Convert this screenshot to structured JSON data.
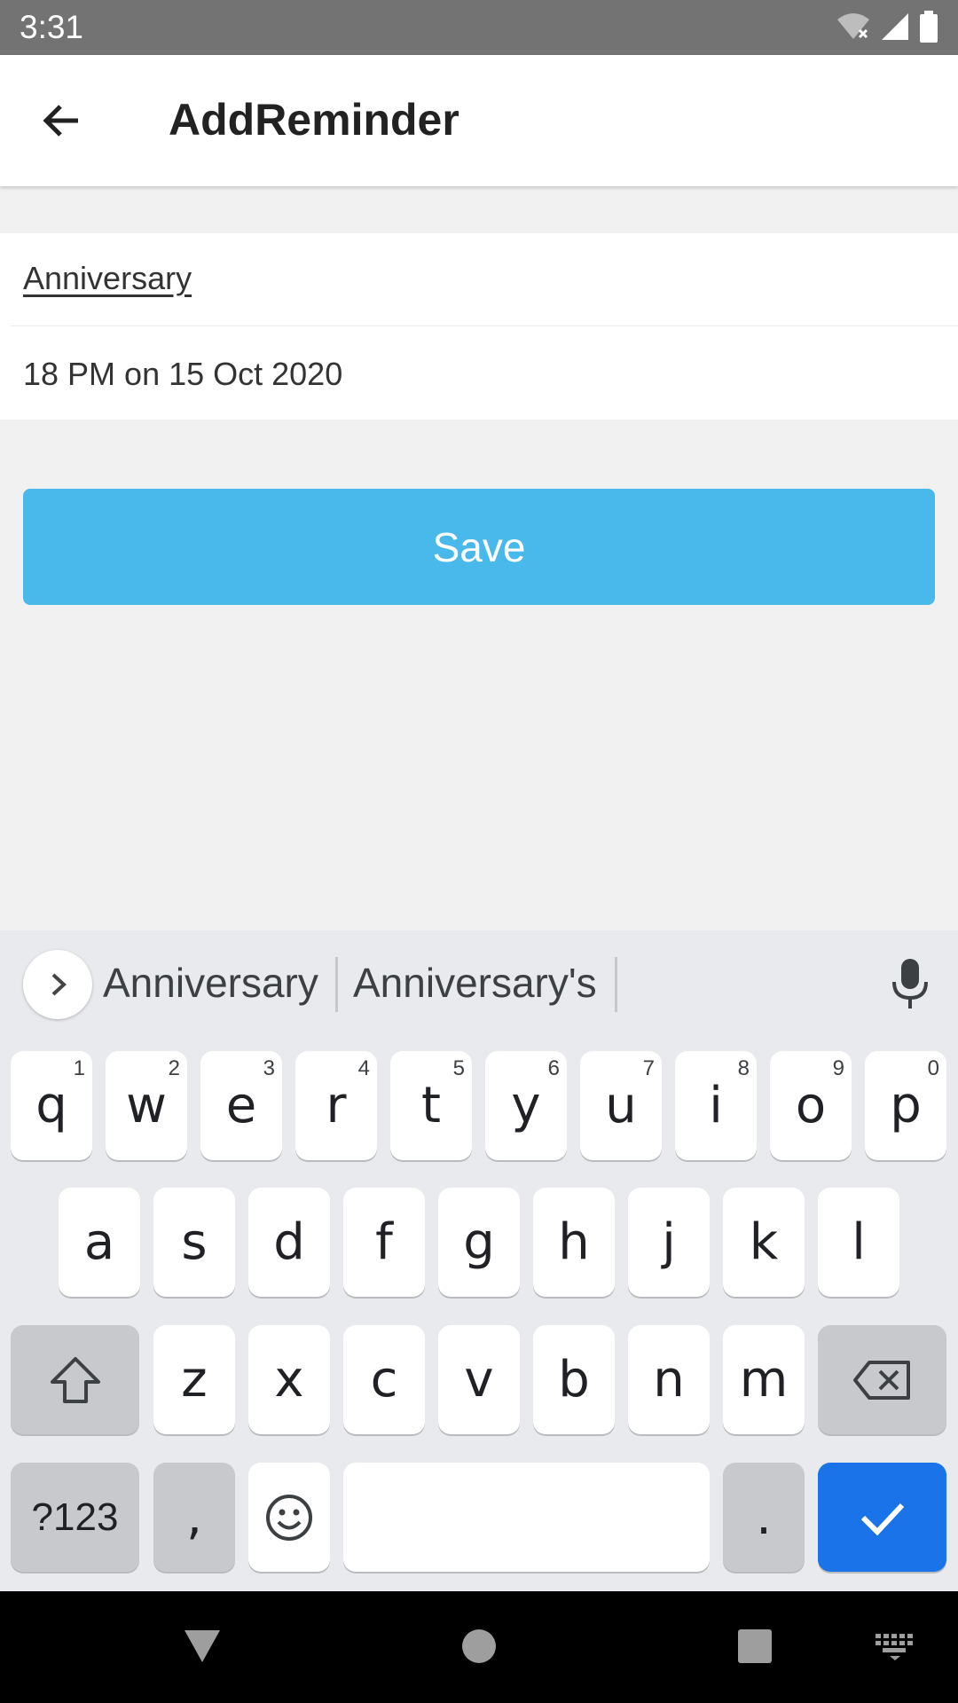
{
  "status_bar": {
    "time": "3:31",
    "icons": [
      "wifi-off-icon",
      "signal-icon",
      "battery-icon"
    ]
  },
  "app_bar": {
    "title": "AddReminder",
    "back_icon": "arrow-left-icon"
  },
  "form": {
    "name_value": "Anniversary",
    "datetime_value": "18 PM on 15 Oct 2020"
  },
  "save_label": "Save",
  "keyboard": {
    "suggestions": [
      "Anniversary",
      "Anniversary's"
    ],
    "row1": [
      {
        "key": "q",
        "hint": "1"
      },
      {
        "key": "w",
        "hint": "2"
      },
      {
        "key": "e",
        "hint": "3"
      },
      {
        "key": "r",
        "hint": "4"
      },
      {
        "key": "t",
        "hint": "5"
      },
      {
        "key": "y",
        "hint": "6"
      },
      {
        "key": "u",
        "hint": "7"
      },
      {
        "key": "i",
        "hint": "8"
      },
      {
        "key": "o",
        "hint": "9"
      },
      {
        "key": "p",
        "hint": "0"
      }
    ],
    "row2": [
      "a",
      "s",
      "d",
      "f",
      "g",
      "h",
      "j",
      "k",
      "l"
    ],
    "row3": [
      "z",
      "x",
      "c",
      "v",
      "b",
      "n",
      "m"
    ],
    "symbols_label": "?123",
    "comma": ",",
    "period": "."
  },
  "colors": {
    "accent": "#49b8ea",
    "enter_key": "#1a73e8",
    "status_bar": "#737373"
  }
}
